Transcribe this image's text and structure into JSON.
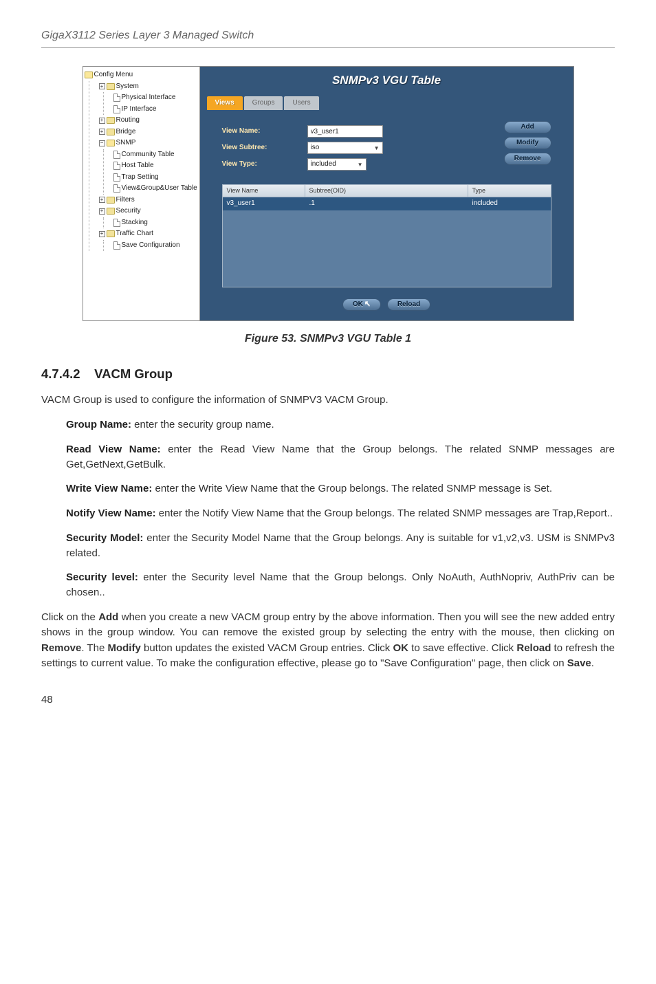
{
  "doc": {
    "header": "GigaX3112 Series Layer 3 Managed Switch",
    "page_number": "48",
    "figure_caption": "Figure 53. SNMPv3 VGU Table 1",
    "section_number": "4.7.4.2",
    "section_title": "VACM Group",
    "intro": "VACM Group is used to configure the information of SNMPV3 VACM Group.",
    "defs": {
      "group_name": {
        "label": "Group Name:",
        "text": " enter the security group name."
      },
      "read_view": {
        "label": "Read View Name:",
        "text": " enter the Read View Name that the Group belongs. The related SNMP messages are Get,GetNext,GetBulk."
      },
      "write_view": {
        "label": "Write View Name:",
        "text": " enter the Write View Name that the Group belongs. The related SNMP message is Set."
      },
      "notify_view": {
        "label": "Notify View Name:",
        "text": " enter the Notify View Name that the Group belongs. The related SNMP messages are Trap,Report.."
      },
      "sec_model": {
        "label": "Security Model:",
        "text": " enter the Security Model Name that the Group belongs. Any is suitable for v1,v2,v3. USM is SNMPv3 related."
      },
      "sec_level": {
        "label": "Security level:",
        "text": " enter the Security level Name that the Group belongs. Only NoAuth, AuthNopriv, AuthPriv can be chosen.."
      }
    },
    "closing_parts": {
      "p1": "Click on the ",
      "add": "Add",
      "p2": " when you create a new VACM group entry by the above information. Then you will see the new added entry shows in the group window. You can remove the existed group by selecting the entry with the mouse, then clicking on ",
      "remove": "Remove",
      "p3": ". The ",
      "modify": "Modify",
      "p4": " button updates the existed VACM Group entries. Click ",
      "ok": "OK",
      "p5": " to save effective. Click ",
      "reload": "Reload",
      "p6": " to refresh the settings to current value. To make the configuration effective, please go to \"Save Configuration\" page, then click on ",
      "save": "Save",
      "p7": "."
    }
  },
  "app": {
    "tree": {
      "root_label": "Config Menu",
      "system": "System",
      "phys_if": "Physical Interface",
      "ip_if": "IP Interface",
      "routing": "Routing",
      "bridge": "Bridge",
      "snmp": "SNMP",
      "community": "Community Table",
      "host_table": "Host Table",
      "trap_setting": "Trap Setting",
      "vgu": "View&Group&User Table",
      "filters": "Filters",
      "security": "Security",
      "stacking": "Stacking",
      "traffic_chart": "Traffic Chart",
      "save_conf": "Save Configuration"
    },
    "title": "SNMPv3 VGU Table",
    "tabs": {
      "views": "Views",
      "groups": "Groups",
      "users": "Users"
    },
    "form": {
      "view_name_label": "View Name:",
      "view_name_value": "v3_user1",
      "view_subtree_label": "View Subtree:",
      "view_subtree_value": "iso",
      "view_type_label": "View Type:",
      "view_type_value": "included"
    },
    "buttons": {
      "add": "Add",
      "modify": "Modify",
      "remove": "Remove",
      "ok": "OK",
      "reload": "Reload"
    },
    "table": {
      "col_name": "View Name",
      "col_sub": "Subtree(OID)",
      "col_type": "Type",
      "rows": [
        {
          "name": "v3_user1",
          "subtree": ".1",
          "type": "included"
        }
      ]
    }
  }
}
